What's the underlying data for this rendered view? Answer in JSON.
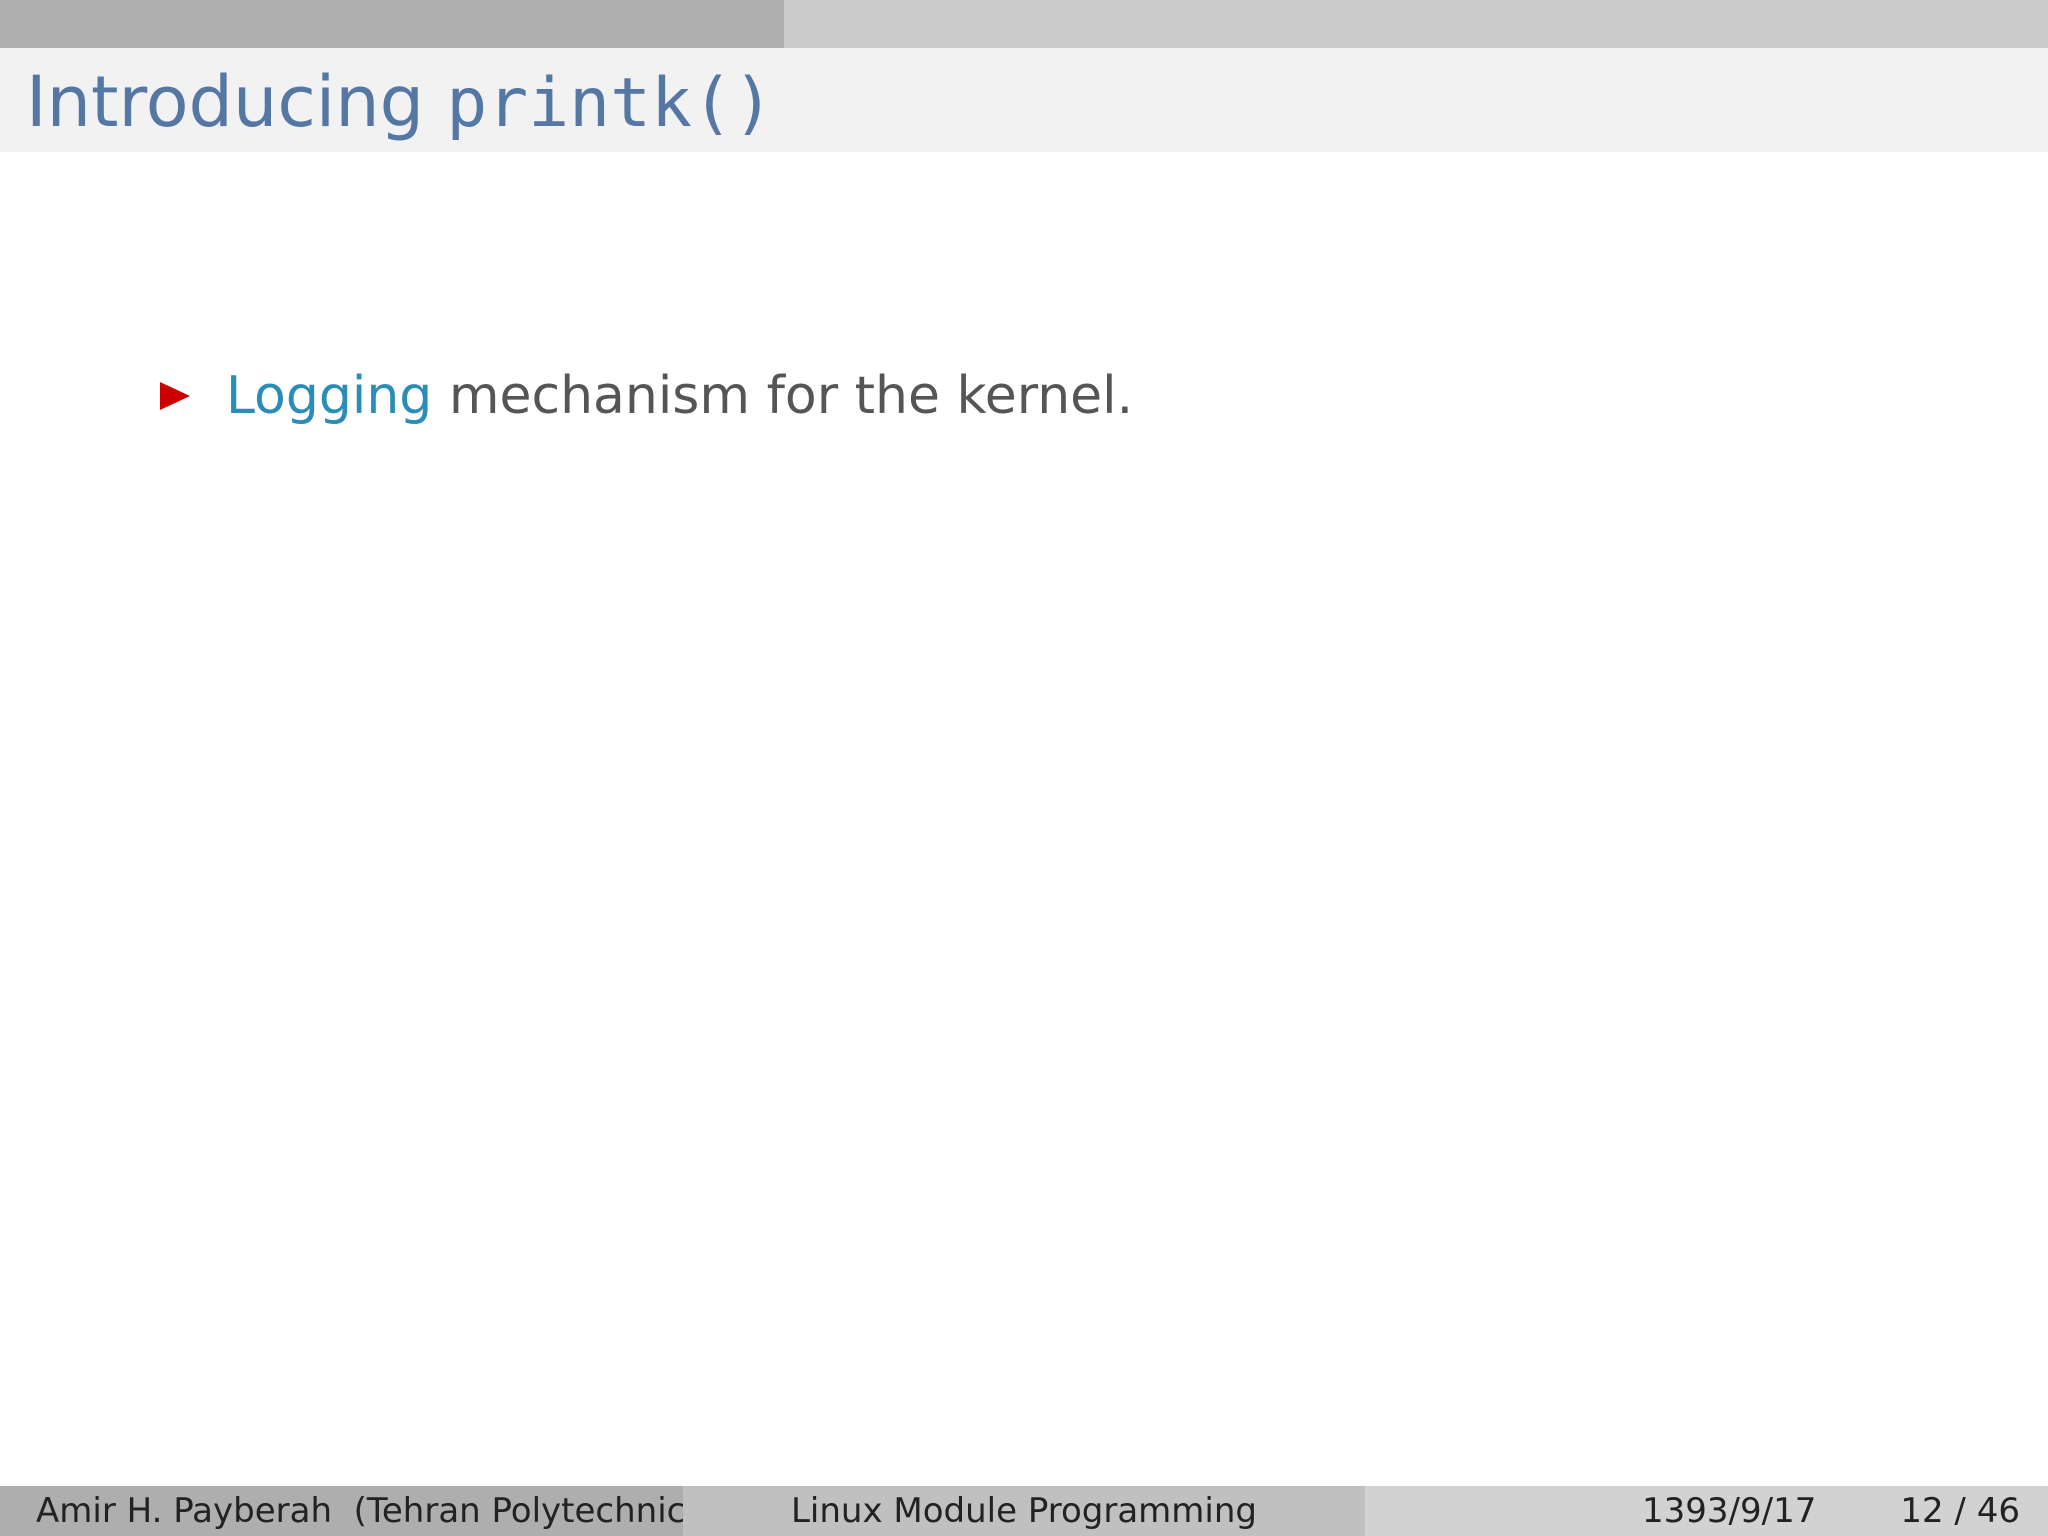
{
  "progress": {
    "fraction": 0.383
  },
  "slide": {
    "title_text": "Introducing ",
    "title_code": "printk()",
    "bullets": [
      {
        "highlight": "Logging",
        "rest": " mechanism for the kernel."
      }
    ]
  },
  "footer": {
    "author": "Amir H. Payberah",
    "institution": "(Tehran Polytechnic)",
    "course": "Linux Module Programming",
    "date": "1393/9/17",
    "page_current": "12",
    "page_separator": "/",
    "page_total": "46"
  },
  "colors": {
    "title": "#5577a4",
    "bullet_marker": "#cc0000",
    "highlight": "#2a8cb8",
    "body_text": "#555555"
  }
}
